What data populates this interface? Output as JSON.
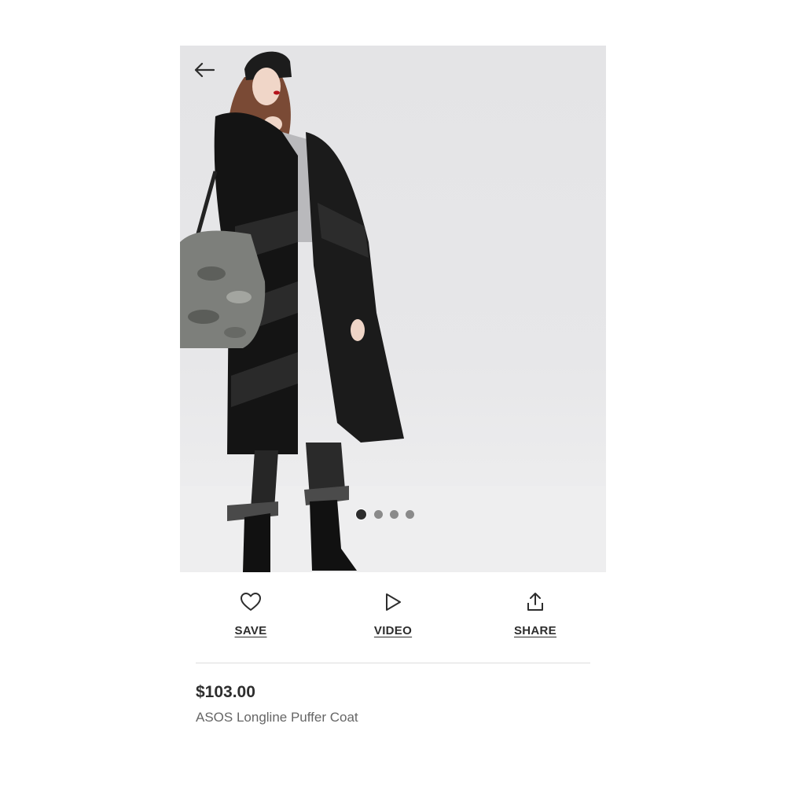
{
  "navigation": {
    "back_icon": "back-arrow-icon"
  },
  "product_image": {
    "description_icon": "product-photo",
    "carousel": {
      "total": 4,
      "active_index": 0
    }
  },
  "actions": [
    {
      "id": "save",
      "label": "SAVE",
      "icon": "heart-icon"
    },
    {
      "id": "video",
      "label": "VIDEO",
      "icon": "play-icon"
    },
    {
      "id": "share",
      "label": "SHARE",
      "icon": "share-icon"
    }
  ],
  "product": {
    "price": "$103.00",
    "name": "ASOS Longline Puffer Coat"
  },
  "colors": {
    "text_primary": "#2d2d2d",
    "text_secondary": "#666666",
    "divider": "#dddddd",
    "photo_background": "#e6e6e8"
  }
}
